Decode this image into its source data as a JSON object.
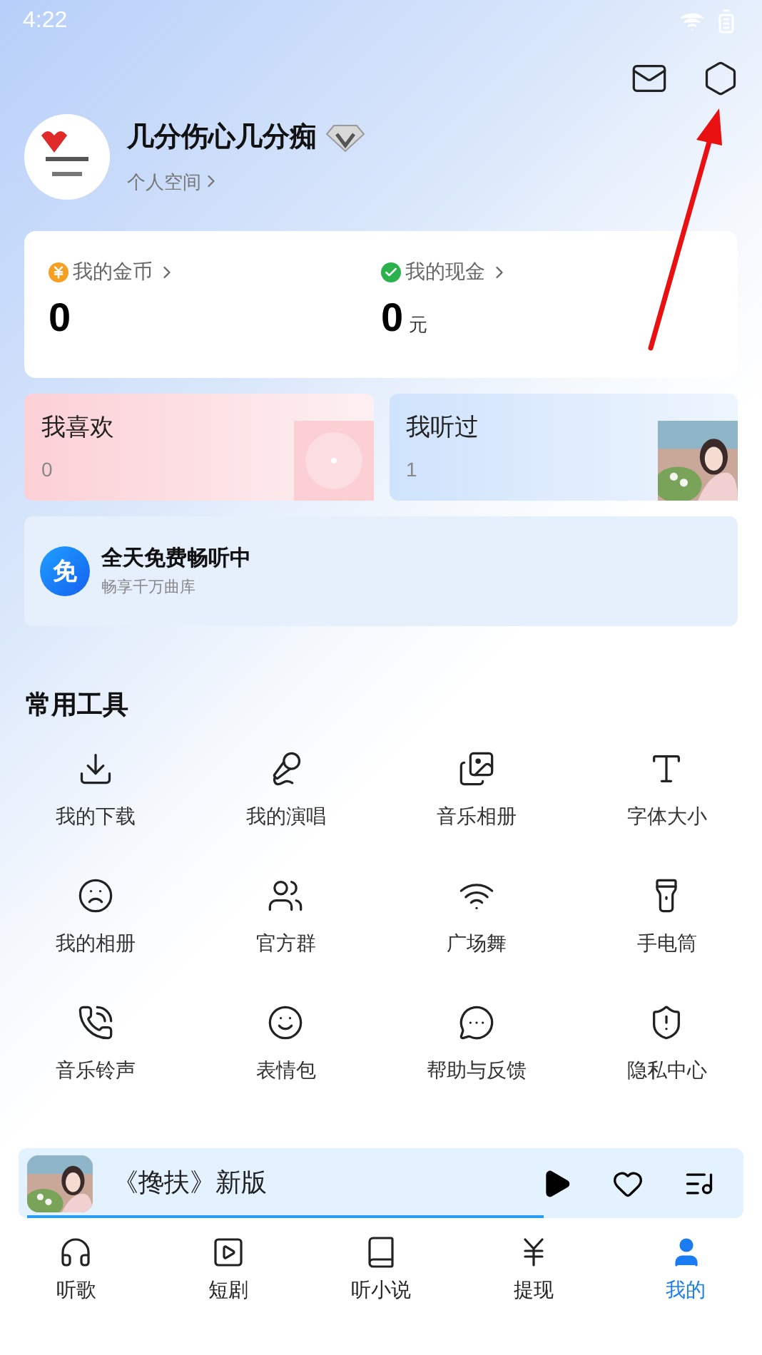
{
  "status_bar": {
    "time": "4:22"
  },
  "profile": {
    "name": "几分伤心几分痴",
    "link": "个人空间"
  },
  "wallet": [
    {
      "kind": "coin",
      "label": "我的金币",
      "value": "0"
    },
    {
      "kind": "cash",
      "label": "我的现金",
      "value": "0",
      "unit": "元"
    }
  ],
  "collections": [
    {
      "kind": "liked",
      "title": "我喜欢",
      "count": "0"
    },
    {
      "kind": "history",
      "title": "我听过",
      "count": "1"
    }
  ],
  "banner": {
    "badge": "免",
    "title": "全天免费畅听中",
    "subtitle": "畅享千万曲库"
  },
  "tools": {
    "title": "常用工具",
    "items": [
      {
        "kind": "download",
        "label": "我的下载"
      },
      {
        "kind": "sing",
        "label": "我的演唱"
      },
      {
        "kind": "album",
        "label": "音乐相册"
      },
      {
        "kind": "font",
        "label": "字体大小"
      },
      {
        "kind": "photos",
        "label": "我的相册"
      },
      {
        "kind": "group",
        "label": "官方群"
      },
      {
        "kind": "dance",
        "label": "广场舞"
      },
      {
        "kind": "flashlight",
        "label": "手电筒"
      },
      {
        "kind": "ringtone",
        "label": "音乐铃声"
      },
      {
        "kind": "emoji",
        "label": "表情包"
      },
      {
        "kind": "help",
        "label": "帮助与反馈"
      },
      {
        "kind": "privacy",
        "label": "隐私中心"
      }
    ]
  },
  "player": {
    "title": "《搀扶》新版",
    "level": 0.73
  },
  "nav": [
    {
      "kind": "music",
      "label": "听歌",
      "selected": false
    },
    {
      "kind": "drama",
      "label": "短剧",
      "selected": false
    },
    {
      "kind": "novel",
      "label": "听小说",
      "selected": false
    },
    {
      "kind": "cash",
      "label": "提现",
      "selected": false
    },
    {
      "kind": "me",
      "label": "我的",
      "selected": true
    }
  ]
}
